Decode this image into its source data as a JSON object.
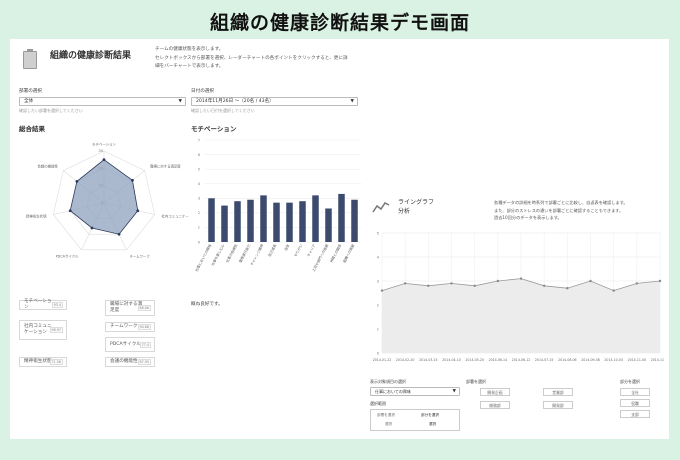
{
  "page_title": "組織の健康診断結果デモ画面",
  "header": {
    "app_title": "組織の健康診断結果",
    "desc_lines": [
      "チームの健康状態を表示します。",
      "セレクトボックスから部署を選択、レーダーチャートの各ポイントをクリックすると、更に詳",
      "細をバーチャートで表示します。"
    ]
  },
  "filters": {
    "dept_label": "部署の選択",
    "dept_value": "全体",
    "dept_hint": "確認したい部署を選択してください",
    "date_label": "日付の選択",
    "date_value": "2014年11月26日 〜（20名 / 43名）",
    "date_hint": "確認したい日付を選択してください"
  },
  "summary": {
    "title": "総合結果",
    "ticks": [
      "30",
      "20",
      "10",
      "0"
    ],
    "chips": [
      {
        "label": "モチベーション",
        "value": "93.4"
      },
      {
        "label": "職場に対する満足度",
        "value": "88.06"
      },
      {
        "label": "社内コミュニケーション",
        "value": "98.97"
      },
      {
        "label": "チームワーク",
        "value": "90.86"
      },
      {
        "label": "PDCAサイクル",
        "value": "77.4"
      },
      {
        "label": "精神衛生状態",
        "value": "71.56"
      },
      {
        "label": "会議の機能性",
        "value": "87.95"
      }
    ]
  },
  "bar_panel": {
    "title": "モチベーション",
    "ticks": [
      "7",
      "6",
      "5",
      "4",
      "3",
      "2",
      "1",
      "0"
    ],
    "footer": "概ね良好です。"
  },
  "ring": {
    "title_line1": "ライングラフ",
    "title_line2": "分析",
    "desc_lines": [
      "各種データの詳細を時系列で部署ごとに比較し、自返表を確認します。",
      "また、部分のストレスの違いを部署ごとに確認することもできます。",
      "過去10回分のデータを表示します。"
    ],
    "y_ticks": [
      "5",
      "4",
      "3",
      "2",
      "1",
      "0"
    ],
    "target_label": "表示対象項目の選択",
    "target_value": "仕事においての興味",
    "period_label": "選択範囲",
    "period_headers": [
      "部署を選択",
      "部分を選択"
    ],
    "period_values": [
      "選択",
      "選択"
    ],
    "dept_label": "部署を選択",
    "dept_buttons": [
      "開発企画",
      "営業部",
      "総務部",
      "開発部"
    ],
    "group_label": "部分を選択",
    "group_buttons": [
      "全社",
      "役職",
      "支部"
    ]
  },
  "chart_data": [
    {
      "type": "radar",
      "title": "総合結果",
      "categories": [
        "モチベーション",
        "職場に対する満足度",
        "社内コミュニケーション",
        "チームワーク",
        "PDCAサイクル",
        "精神衛生状態",
        "会議の機能性"
      ],
      "values": [
        25,
        21,
        20,
        20,
        16,
        20,
        20
      ],
      "ylim": [
        0,
        30
      ]
    },
    {
      "type": "bar",
      "title": "モチベーション",
      "categories": [
        "仕事においての興味",
        "仕事を楽しむ心",
        "仕事の自律性",
        "業務遂行能力",
        "チャレンジ精神",
        "自己成長",
        "自信",
        "やりがい",
        "キャリア",
        "上司や部門への信頼",
        "仲間との関係",
        "組織への貢献",
        "目標の明確",
        "方向性の一致"
      ],
      "values": [
        3.0,
        2.5,
        2.8,
        2.9,
        3.2,
        2.7,
        2.7,
        2.8,
        3.2,
        2.3,
        3.3,
        2.9
      ],
      "ylim": [
        0,
        7
      ]
    },
    {
      "type": "area",
      "x": [
        "2014-01-22",
        "2014-02-20",
        "2014-03-15",
        "2014-04-10",
        "2014-05-20",
        "2014-06-14",
        "2014-06-12",
        "2014-07-15",
        "2014-08-06",
        "2014-09-08",
        "2014-10-04",
        "2014-11-00",
        "2014-11-26"
      ],
      "values": [
        2.6,
        2.9,
        2.8,
        2.9,
        2.8,
        3.0,
        3.1,
        2.8,
        2.7,
        3.0,
        2.6,
        2.9,
        3.0
      ],
      "ylim": [
        0,
        5
      ]
    }
  ],
  "colors": {
    "bar": "#3c4a6e",
    "radar_fill": "#8fa2bf",
    "radar_stroke": "#2d3a5a",
    "area_fill": "#ececec",
    "area_stroke": "#999999"
  }
}
